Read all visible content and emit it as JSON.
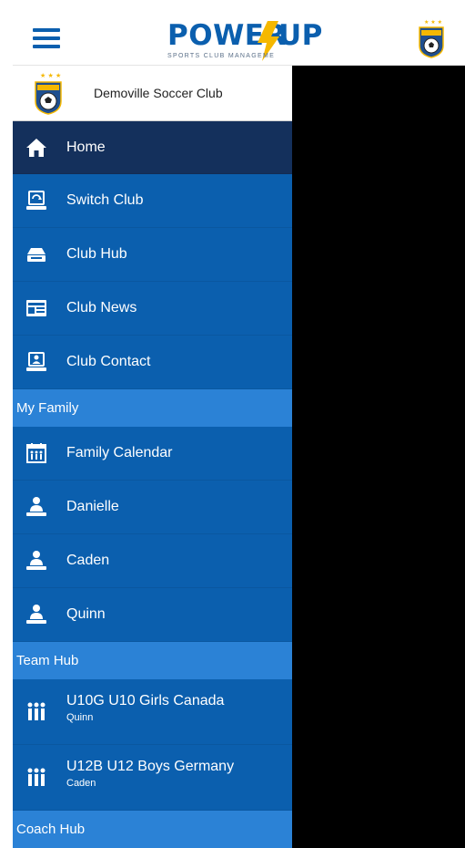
{
  "appbar": {
    "logo_word_1": "POWER",
    "logo_word_2": "UP",
    "logo_tagline": "SPORTS CLUB MANAGEMENT",
    "crest_text": "SOCCER"
  },
  "drawer": {
    "club_name": "Demoville Soccer Club",
    "items": [
      {
        "label": "Home",
        "icon": "home-icon"
      },
      {
        "label": "Switch Club",
        "icon": "switch-club-icon"
      },
      {
        "label": "Club Hub",
        "icon": "club-hub-icon"
      },
      {
        "label": "Club News",
        "icon": "news-icon"
      },
      {
        "label": "Club Contact",
        "icon": "contact-icon"
      }
    ],
    "family_section": "My Family",
    "family_items": [
      {
        "label": "Family Calendar",
        "icon": "family-calendar-icon"
      },
      {
        "label": "Danielle",
        "icon": "person-icon"
      },
      {
        "label": "Caden",
        "icon": "person-icon"
      },
      {
        "label": "Quinn",
        "icon": "person-icon"
      }
    ],
    "team_section": "Team Hub",
    "team_items": [
      {
        "label": "U10G U10 Girls Canada",
        "sub": "Quinn",
        "icon": "team-icon"
      },
      {
        "label": "U12B U12 Boys Germany",
        "sub": "Caden",
        "icon": "team-icon"
      }
    ],
    "coach_section": "Coach Hub"
  },
  "colors": {
    "brand_blue": "#0b5fae",
    "active_item": "#14305c",
    "section_header": "#2b82d6",
    "logo_bolt": "#f5b800"
  }
}
